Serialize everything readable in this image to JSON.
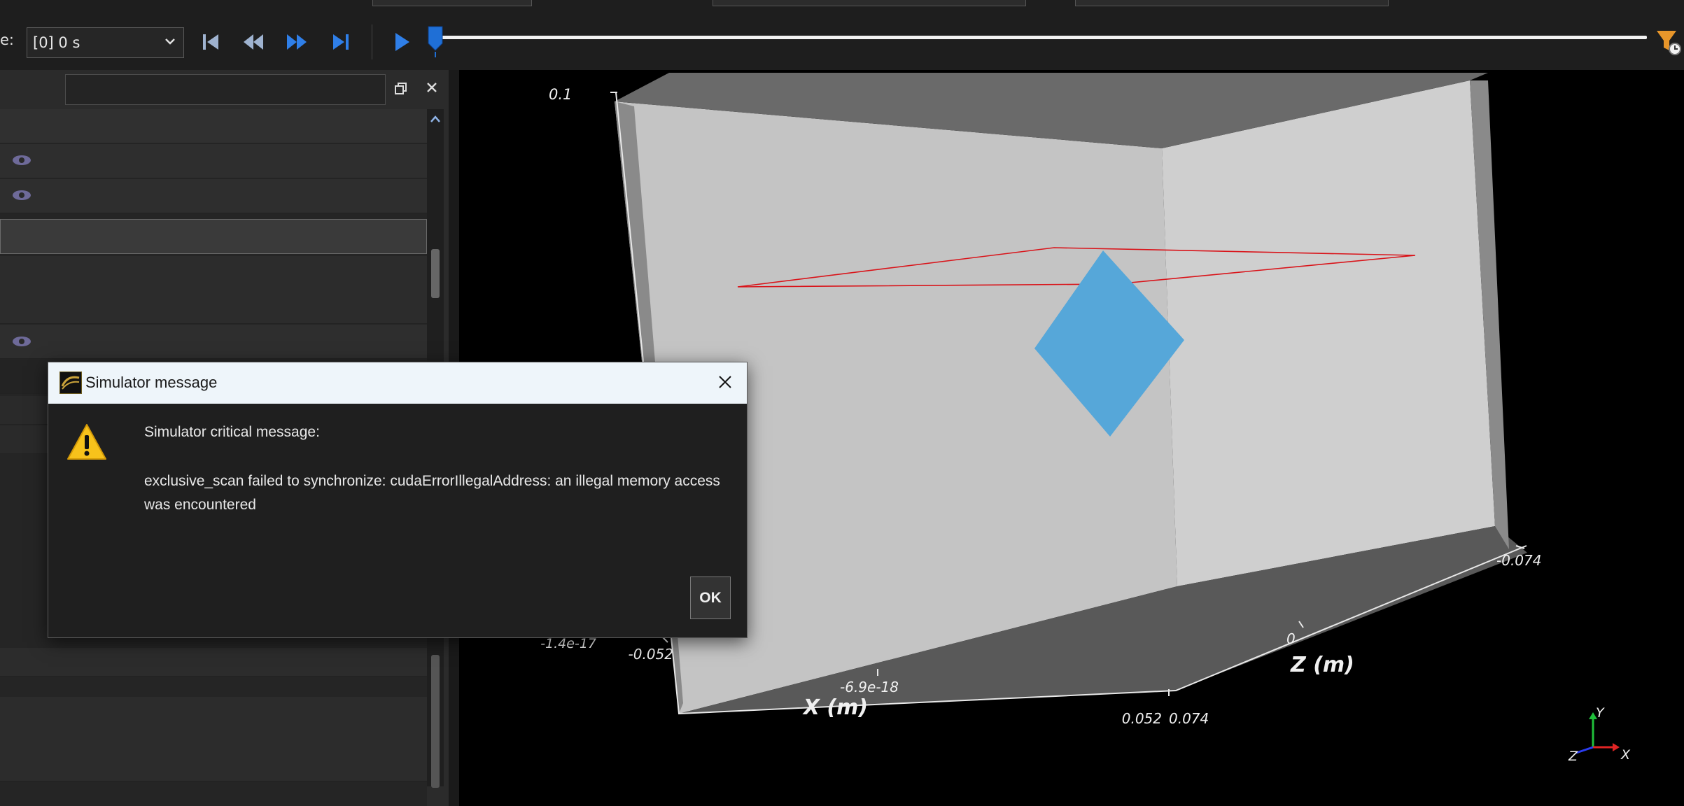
{
  "toolbar": {
    "time_label": "e:",
    "time_select_value": "[0] 0 s",
    "timeline_progress": 0.0
  },
  "viewport": {
    "colors": {
      "box_light": "#c4c4c4",
      "box_dark": "#595959",
      "object": "#56a7d9",
      "wire": "#d9141a"
    },
    "labels": {
      "y_top": "0.1",
      "x_tick_min": "-1.4e-17",
      "x_tick_a": "-0.052",
      "x_tick_mid": "-6.9e-18",
      "x_axis": "X (m)",
      "x_tick_end": "0.052",
      "z_tick_end": "0.074",
      "z_tick_mid": "0",
      "z_axis": "Z (m)",
      "z_tick_start": "-0.074"
    },
    "orientation": {
      "y": "Y",
      "x": "X",
      "z": "Z"
    }
  },
  "dialog": {
    "title": "Simulator message",
    "heading": "Simulator critical message:",
    "body": "exclusive_scan failed to synchronize: cudaErrorIllegalAddress: an illegal memory access was encountered",
    "ok_label": "OK"
  }
}
